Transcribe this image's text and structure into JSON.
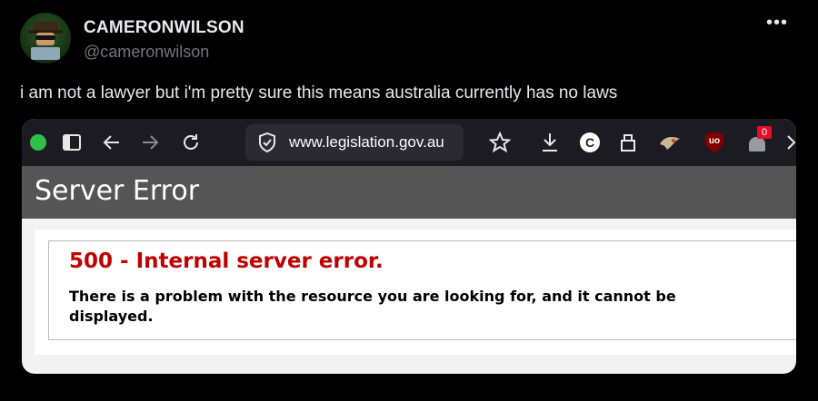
{
  "author": {
    "display_name": "CAMERONWILSON",
    "handle": "@cameronwilson"
  },
  "more_menu": "•••",
  "tweet_text": "i am not a lawyer but i'm pretty sure this means australia currently has no laws",
  "browser": {
    "url": "www.legislation.gov.au",
    "notification_count": "0",
    "extension_c_label": "C",
    "ublock_label": "uo"
  },
  "page": {
    "header_title": "Server Error",
    "error_title": "500 - Internal server error.",
    "error_description": "There is a problem with the resource you are looking for, and it cannot be displayed."
  },
  "icons": [
    "avatar",
    "sidebar-toggle-icon",
    "back-arrow-icon",
    "forward-arrow-icon",
    "reload-icon",
    "shield-icon",
    "bookmark-star-icon",
    "download-icon",
    "share-icon",
    "extension-icon",
    "ublock-icon",
    "notification-icon",
    "overflow-chevron-icon"
  ],
  "colors": {
    "error_red": "#c00000",
    "header_gray": "#555555",
    "toolbar_bg": "#1c1b22"
  }
}
